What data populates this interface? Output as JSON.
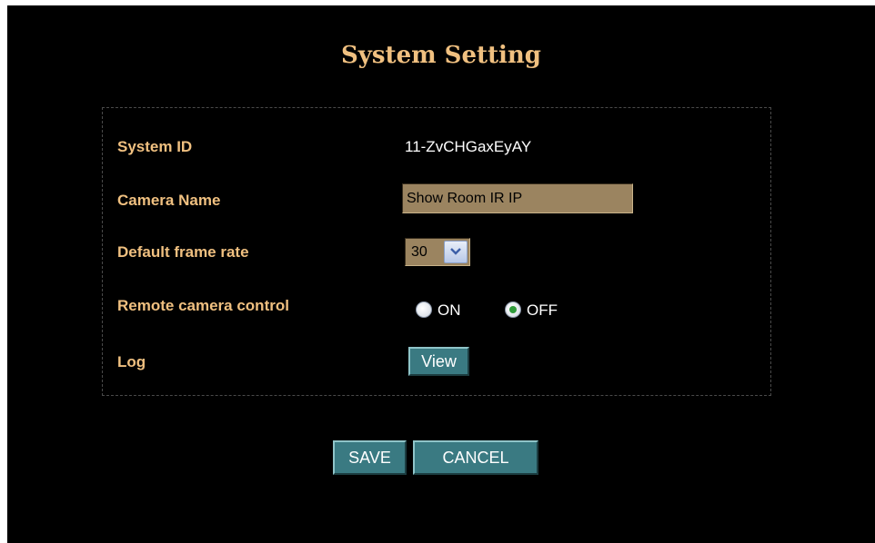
{
  "title": "System Setting",
  "system_id": {
    "label": "System ID",
    "value": "11-ZvCHGaxEyAY"
  },
  "camera_name": {
    "label": "Camera Name",
    "value": "Show Room IR IP"
  },
  "frame_rate": {
    "label": "Default frame rate",
    "selected": "30",
    "icon": "chevron-down-icon"
  },
  "remote_control": {
    "label": "Remote camera control",
    "on_label": "ON",
    "off_label": "OFF",
    "selected": "OFF"
  },
  "log": {
    "label": "Log",
    "view_button": "View"
  },
  "actions": {
    "save": "SAVE",
    "cancel": "CANCEL"
  },
  "colors": {
    "background": "#000000",
    "label": "#f0c080",
    "input_bg": "#9b8460",
    "button": "#3a7a82"
  }
}
